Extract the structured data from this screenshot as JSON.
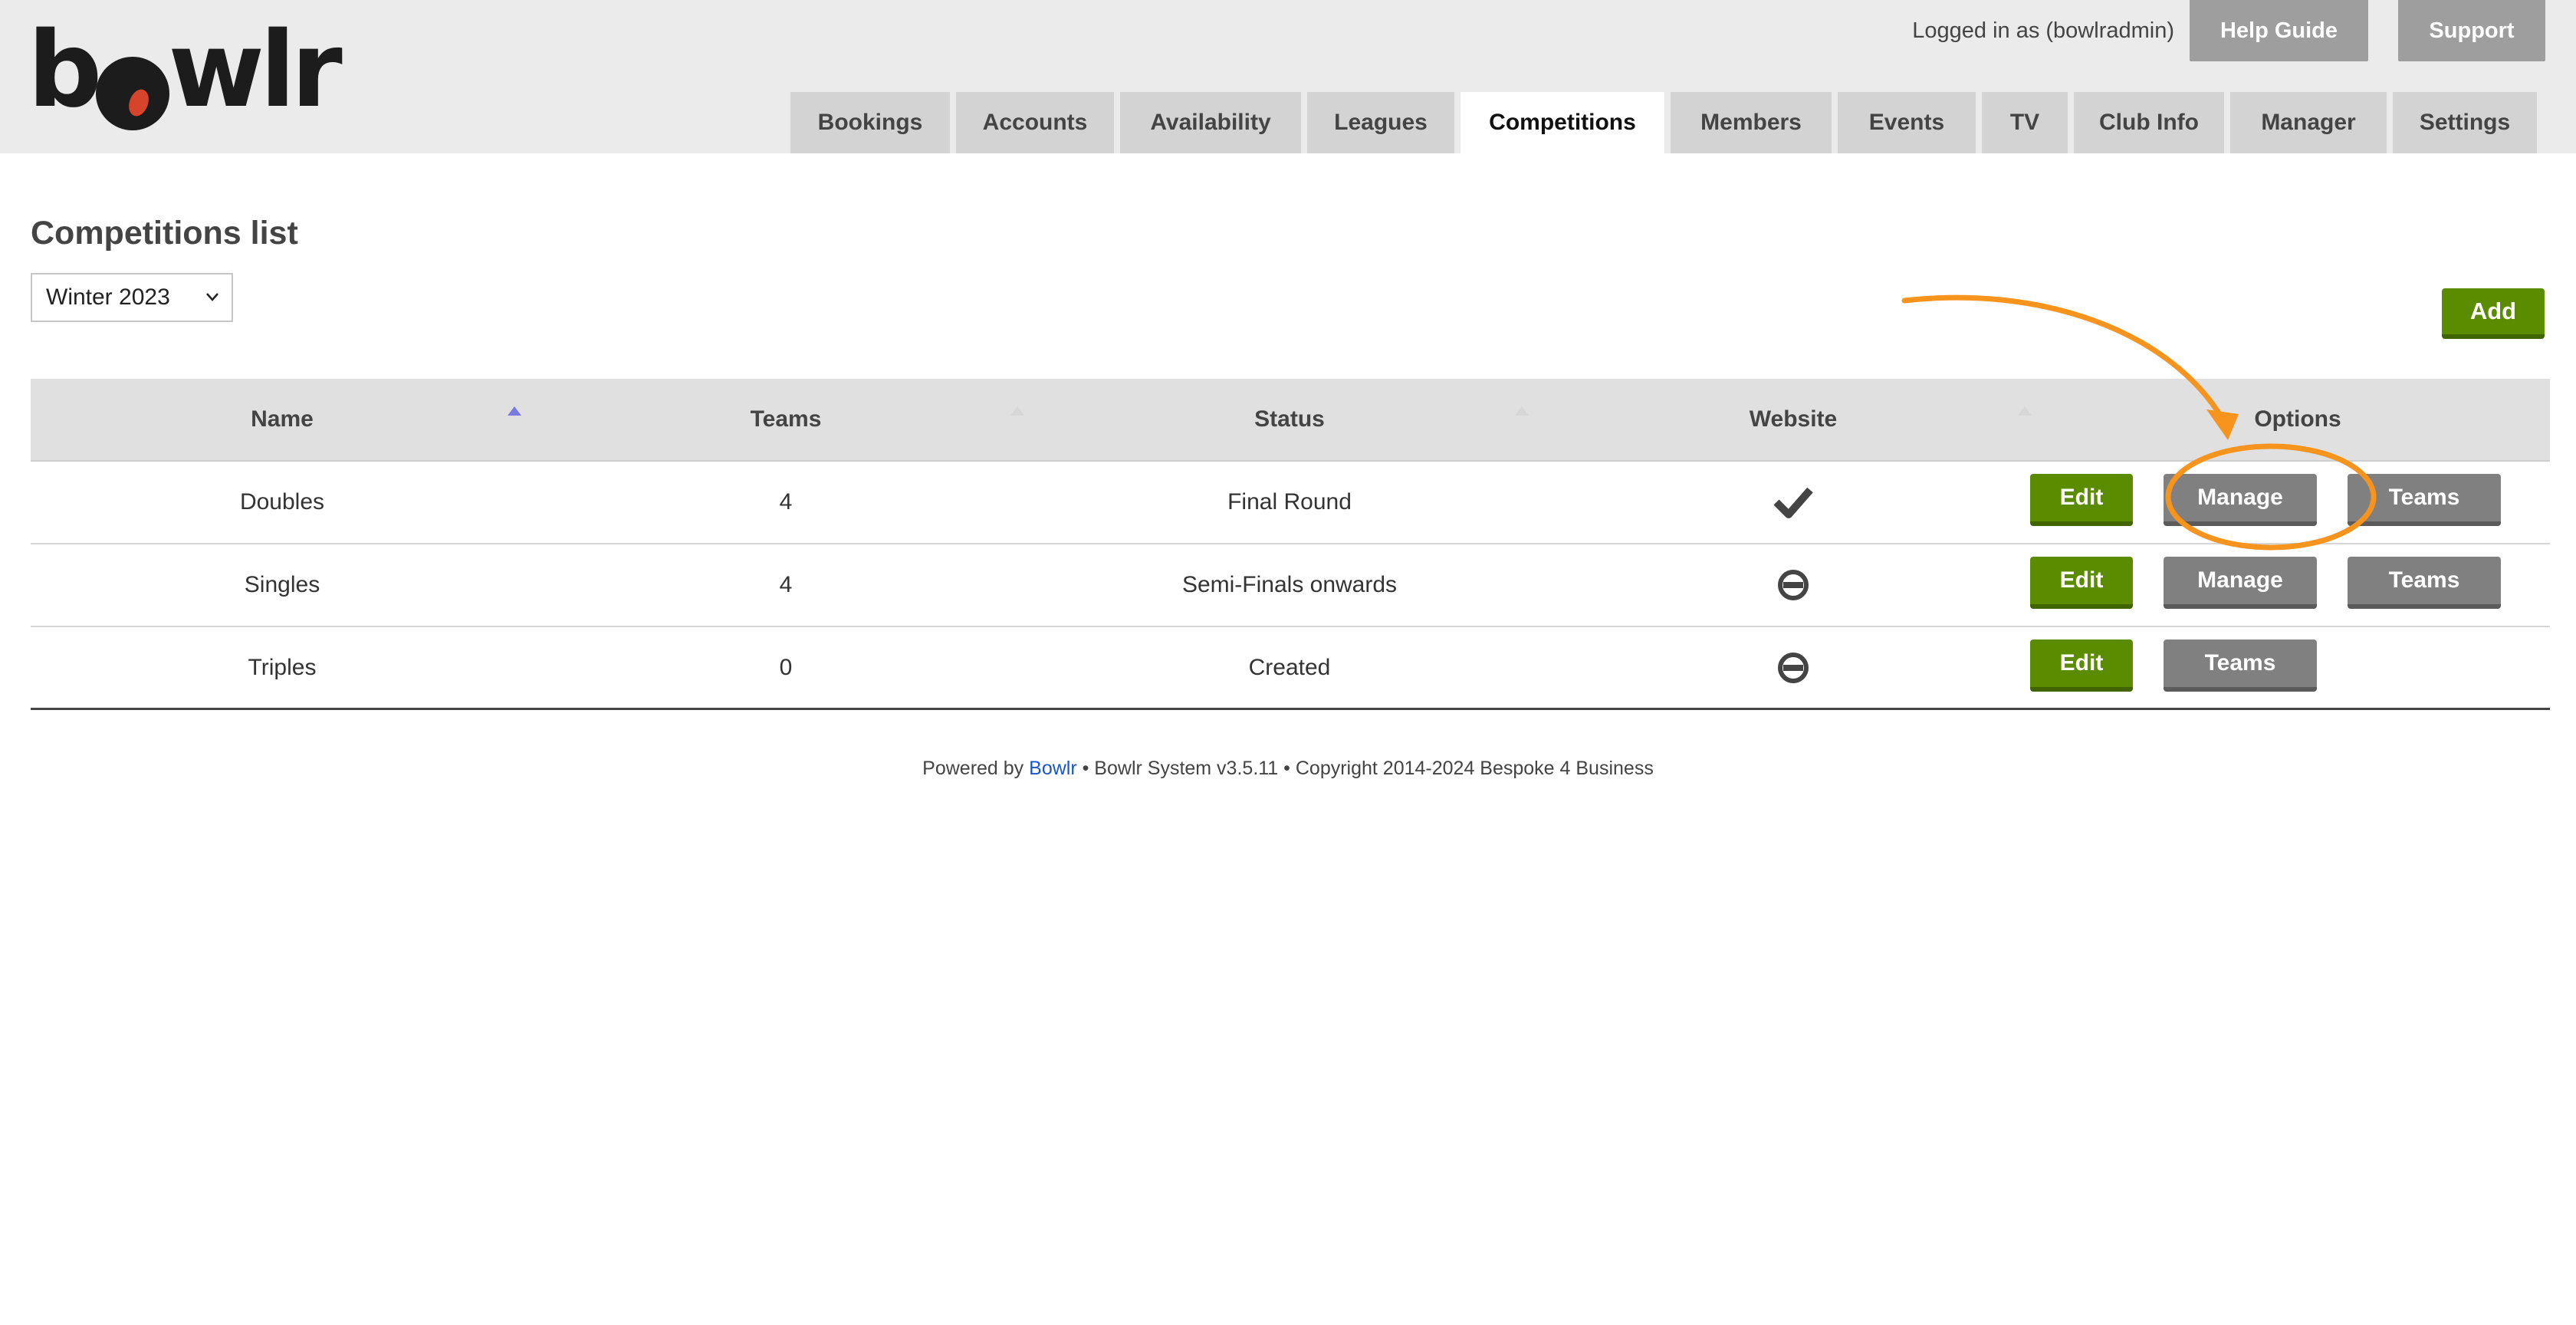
{
  "app": {
    "logo_left": "b",
    "logo_right": "wlr",
    "logged_in": "Logged in as (bowlradmin)",
    "help_label": "Help Guide",
    "support_label": "Support"
  },
  "tabs": [
    {
      "label": "Bookings",
      "active": false
    },
    {
      "label": "Accounts",
      "active": false
    },
    {
      "label": "Availability",
      "active": false
    },
    {
      "label": "Leagues",
      "active": false
    },
    {
      "label": "Competitions",
      "active": true
    },
    {
      "label": "Members",
      "active": false
    },
    {
      "label": "Events",
      "active": false
    },
    {
      "label": "TV",
      "active": false
    },
    {
      "label": "Club Info",
      "active": false
    },
    {
      "label": "Manager",
      "active": false
    },
    {
      "label": "Settings",
      "active": false
    }
  ],
  "page": {
    "title": "Competitions list",
    "season_selected": "Winter 2023",
    "add_label": "Add"
  },
  "table": {
    "headers": {
      "name": "Name",
      "teams": "Teams",
      "status": "Status",
      "website": "Website",
      "options": "Options"
    },
    "rows": [
      {
        "name": "Doubles",
        "teams": "4",
        "status": "Final Round",
        "website": "check-icon",
        "actions": [
          "Edit",
          "Manage",
          "Teams"
        ]
      },
      {
        "name": "Singles",
        "teams": "4",
        "status": "Semi-Finals onwards",
        "website": "no-entry-icon",
        "actions": [
          "Edit",
          "Manage",
          "Teams"
        ]
      },
      {
        "name": "Triples",
        "teams": "0",
        "status": "Created",
        "website": "no-entry-icon",
        "actions": [
          "Edit",
          "Teams"
        ]
      }
    ]
  },
  "footer": {
    "prefix": "Powered by",
    "link": "Bowlr",
    "suffix": "• Bowlr System v3.5.11 • Copyright 2014-2024 Bespoke 4 Business"
  },
  "colors": {
    "green_button": "#5b8c00",
    "grey_button": "#808080",
    "annotation": "#f7941d"
  }
}
